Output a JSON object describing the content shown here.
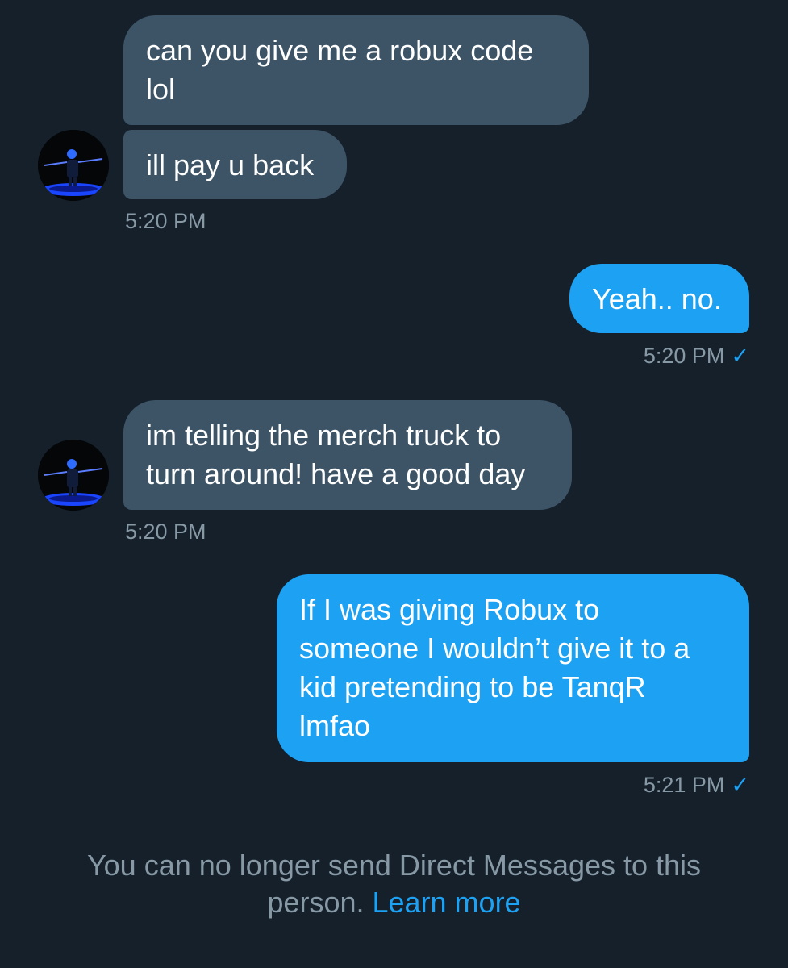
{
  "messages": [
    {
      "text": "can you give me a robux code\nlol"
    },
    {
      "text": "ill pay u back"
    },
    {
      "time": "5:20 PM"
    },
    {
      "text": "Yeah.. no.",
      "time": "5:20 PM"
    },
    {
      "text": "im telling the merch truck to\nturn around! have a good day",
      "time": "5:20 PM"
    },
    {
      "text": "If I was giving Robux to\nsomeone I wouldn’t give it to a\nkid pretending to be TanqR\nlmfao",
      "time": "5:21 PM"
    }
  ],
  "footer": {
    "notice": "You can no longer send Direct Messages to this person. ",
    "link": "Learn more"
  },
  "icons": {
    "read_check": "checkmark-icon",
    "avatar": "user-avatar"
  },
  "colors": {
    "background": "#15202b",
    "incoming_bubble": "#3d5466",
    "outgoing_bubble": "#1da1f2",
    "muted_text": "#8899a6",
    "link": "#1da1f2"
  }
}
